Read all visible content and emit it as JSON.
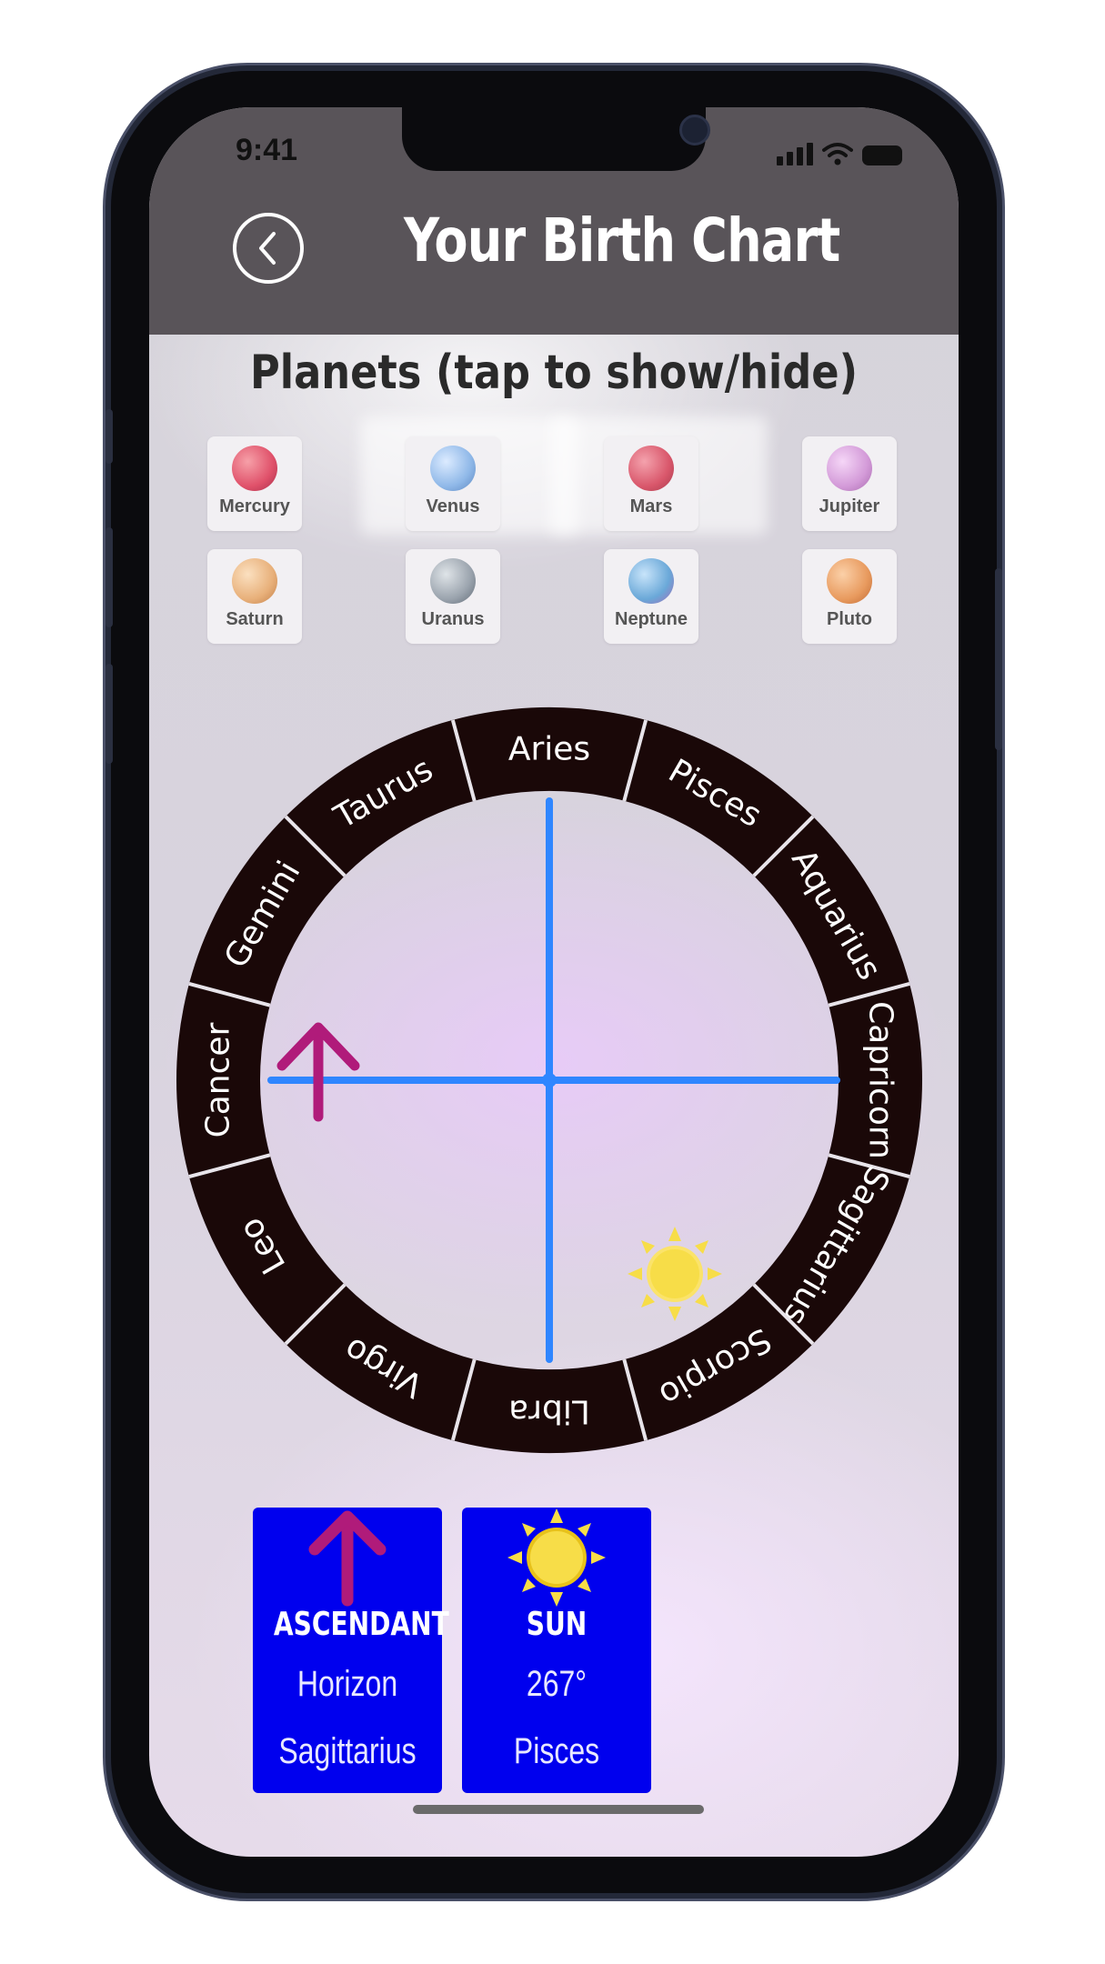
{
  "status_bar": {
    "time": "9:41"
  },
  "header": {
    "title": "Your Birth Chart",
    "back_icon": "chevron-left-icon"
  },
  "planets_section": {
    "title": "Planets (tap to show/hide)",
    "planets": [
      {
        "name": "Mercury",
        "color": "#e0516a"
      },
      {
        "name": "Venus",
        "color": "#8fb8e8"
      },
      {
        "name": "Mars",
        "color": "#d9576b"
      },
      {
        "name": "Jupiter",
        "color": "#d39ad8"
      },
      {
        "name": "Saturn",
        "color": "#e8b07a"
      },
      {
        "name": "Uranus",
        "color": "#9aa3ad"
      },
      {
        "name": "Neptune",
        "color": "#6aa8d8"
      },
      {
        "name": "Pluto",
        "color": "#e89a5e"
      }
    ]
  },
  "zodiac_wheel": {
    "signs": [
      "Aries",
      "Pisces",
      "Aquarius",
      "Capricorn",
      "Sagittarius",
      "Scorpio",
      "Libra",
      "Virgo",
      "Leo",
      "Cancer",
      "Gemini",
      "Taurus"
    ],
    "ring_color": "#1a0808",
    "axis_color": "#2f86ff",
    "ascendant_marker": "up-arrow-icon",
    "sun_marker": "sun-icon"
  },
  "cards": [
    {
      "icon": "up-arrow-icon",
      "label": "ASCENDANT",
      "line1": "Horizon",
      "line2": "Sagittarius"
    },
    {
      "icon": "sun-icon",
      "label": "SUN",
      "line1": "267°",
      "line2": "Pisces"
    }
  ],
  "colors": {
    "card_bg": "#0000ee",
    "header_bg": "#595459",
    "arrow": "#b01b7a",
    "sun": "#f7dd48"
  }
}
